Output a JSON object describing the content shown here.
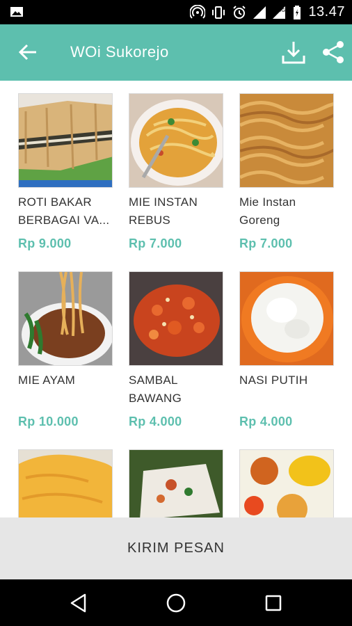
{
  "status": {
    "time": "13.47",
    "network": "4G"
  },
  "toolbar": {
    "title": "WOi Sukorejo"
  },
  "products": [
    {
      "name": "ROTI BAKAR BERBAGAI VA...",
      "price": "Rp 9.000"
    },
    {
      "name": "MIE INSTAN REBUS",
      "price": "Rp 7.000"
    },
    {
      "name": "Mie Instan Goreng",
      "price": "Rp 7.000"
    },
    {
      "name": "MIE AYAM",
      "price": "Rp 10.000"
    },
    {
      "name": "SAMBAL BAWANG",
      "price": "Rp 4.000"
    },
    {
      "name": "NASI PUTIH",
      "price": "Rp 4.000"
    },
    {
      "name": "",
      "price": ""
    },
    {
      "name": "",
      "price": ""
    },
    {
      "name": "",
      "price": ""
    }
  ],
  "bottom": {
    "send_label": "KIRIM PESAN"
  },
  "icons": {
    "back": "arrow-back-icon",
    "download": "download-icon",
    "share": "share-icon"
  },
  "colors": {
    "accent": "#5dbfae",
    "statusbar": "#000000",
    "button_bg": "#e6e6e6"
  }
}
